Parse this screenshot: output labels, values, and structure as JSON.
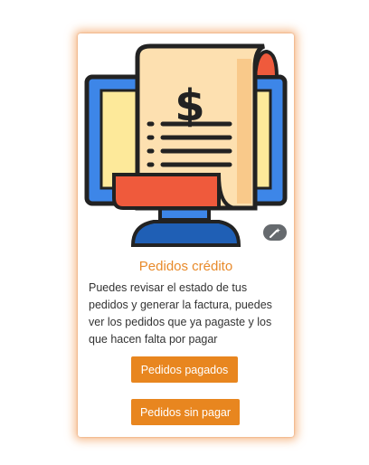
{
  "card": {
    "title": "Pedidos crédito",
    "description": "Puedes revisar el estado de tus pedidos y generar la factura, puedes ver los pedidos que ya pagaste y los que hacen falta por pagar",
    "buttons": {
      "paid_label": "Pedidos pagados",
      "unpaid_label": "Pedidos sin pagar"
    },
    "illustration_symbol": "$"
  },
  "colors": {
    "accent": "#e8861f",
    "title": "#e88a2a",
    "monitor_blue": "#3d86e8",
    "receipt_cream": "#fde0b0",
    "receipt_red": "#ef5a3c"
  },
  "icons": {
    "illustration": "monitor-receipt-dollar-icon",
    "badge": "magic-wand-icon"
  }
}
